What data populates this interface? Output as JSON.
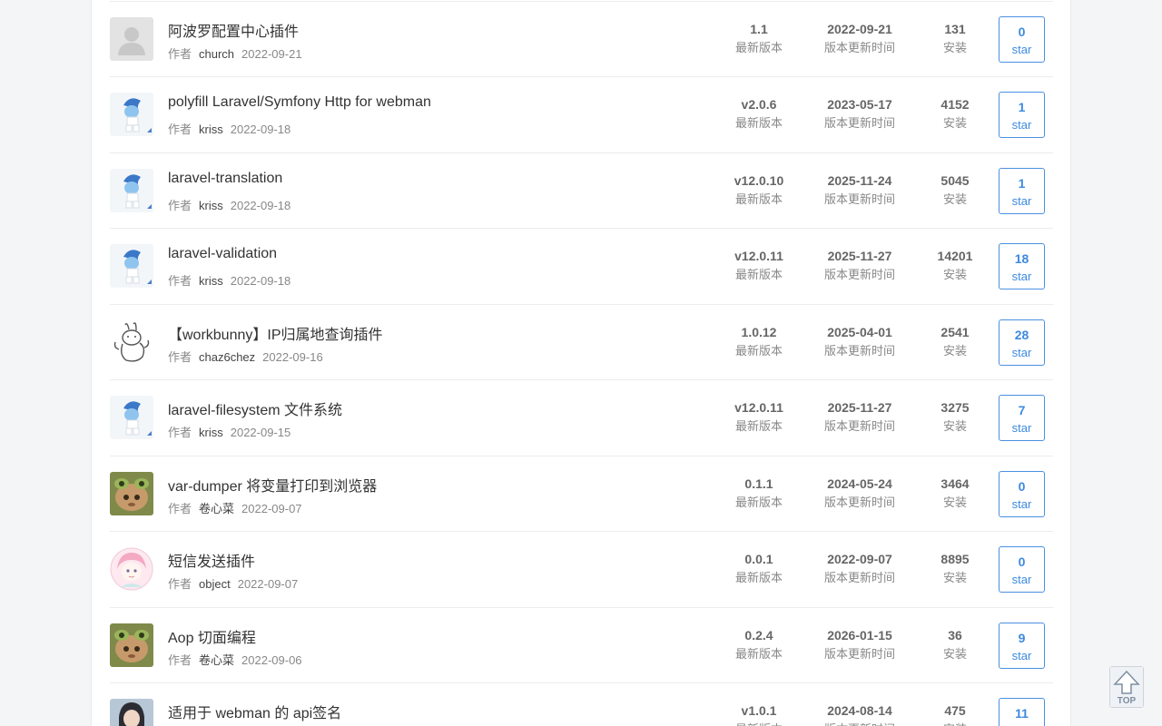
{
  "labels": {
    "author": "作者",
    "version": "最新版本",
    "updated": "版本更新时间",
    "installs": "安装",
    "star": "star"
  },
  "back_to_top": {
    "icon": "arrow-up-icon",
    "label": "TOP"
  },
  "plugins": [
    {
      "title": "",
      "author": "",
      "date": "",
      "version": "",
      "updated": "",
      "installs": "",
      "stars": "",
      "avatar": "blank"
    },
    {
      "title": "阿波罗配置中心插件",
      "author": "church",
      "date": "2022-09-21",
      "version": "1.1",
      "updated": "2022-09-21",
      "installs": "131",
      "stars": "0",
      "avatar": "default-user"
    },
    {
      "title": "polyfill Laravel/Symfony Http for webman",
      "author": "kriss",
      "date": "2022-09-18",
      "version": "v2.0.6",
      "updated": "2023-05-17",
      "installs": "4152",
      "stars": "1",
      "avatar": "smurf"
    },
    {
      "title": "laravel-translation",
      "author": "kriss",
      "date": "2022-09-18",
      "version": "v12.0.10",
      "updated": "2025-11-24",
      "installs": "5045",
      "stars": "1",
      "avatar": "smurf"
    },
    {
      "title": "laravel-validation",
      "author": "kriss",
      "date": "2022-09-18",
      "version": "v12.0.11",
      "updated": "2025-11-27",
      "installs": "14201",
      "stars": "18",
      "avatar": "smurf"
    },
    {
      "title": "【workbunny】IP归属地查询插件",
      "author": "chaz6chez",
      "date": "2022-09-16",
      "version": "1.0.12",
      "updated": "2025-04-01",
      "installs": "2541",
      "stars": "28",
      "avatar": "sketch-rabbit"
    },
    {
      "title": "laravel-filesystem 文件系统",
      "author": "kriss",
      "date": "2022-09-15",
      "version": "v12.0.11",
      "updated": "2025-11-27",
      "installs": "3275",
      "stars": "7",
      "avatar": "smurf"
    },
    {
      "title": "var-dumper 将变量打印到浏览器",
      "author": "卷心菜",
      "date": "2022-09-07",
      "version": "0.1.1",
      "updated": "2024-05-24",
      "installs": "3464",
      "stars": "0",
      "avatar": "frog-cat"
    },
    {
      "title": "短信发送插件",
      "author": "object",
      "date": "2022-09-07",
      "version": "0.0.1",
      "updated": "2022-09-07",
      "installs": "8895",
      "stars": "0",
      "avatar": "anime-girl"
    },
    {
      "title": "Aop 切面编程",
      "author": "卷心菜",
      "date": "2022-09-06",
      "version": "0.2.4",
      "updated": "2026-01-15",
      "installs": "36",
      "stars": "9",
      "avatar": "frog-cat"
    },
    {
      "title": "适用于 webman 的 api签名",
      "author": "",
      "date": "",
      "version": "v1.0.1",
      "updated": "2024-08-14",
      "installs": "475",
      "stars": "11",
      "avatar": "portrait"
    }
  ]
}
